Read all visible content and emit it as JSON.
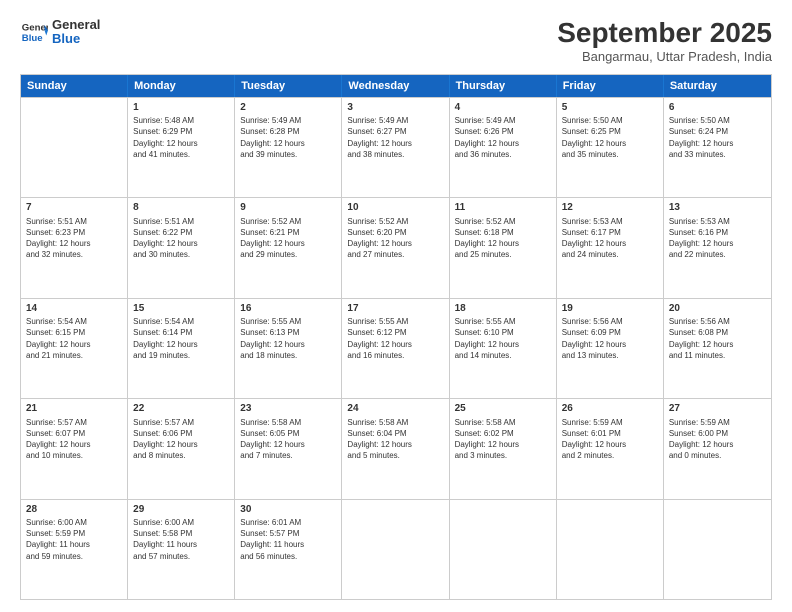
{
  "header": {
    "logo_line1": "General",
    "logo_line2": "Blue",
    "month_title": "September 2025",
    "subtitle": "Bangarmau, Uttar Pradesh, India"
  },
  "days_of_week": [
    "Sunday",
    "Monday",
    "Tuesday",
    "Wednesday",
    "Thursday",
    "Friday",
    "Saturday"
  ],
  "weeks": [
    [
      {
        "day": "",
        "info": ""
      },
      {
        "day": "1",
        "info": "Sunrise: 5:48 AM\nSunset: 6:29 PM\nDaylight: 12 hours\nand 41 minutes."
      },
      {
        "day": "2",
        "info": "Sunrise: 5:49 AM\nSunset: 6:28 PM\nDaylight: 12 hours\nand 39 minutes."
      },
      {
        "day": "3",
        "info": "Sunrise: 5:49 AM\nSunset: 6:27 PM\nDaylight: 12 hours\nand 38 minutes."
      },
      {
        "day": "4",
        "info": "Sunrise: 5:49 AM\nSunset: 6:26 PM\nDaylight: 12 hours\nand 36 minutes."
      },
      {
        "day": "5",
        "info": "Sunrise: 5:50 AM\nSunset: 6:25 PM\nDaylight: 12 hours\nand 35 minutes."
      },
      {
        "day": "6",
        "info": "Sunrise: 5:50 AM\nSunset: 6:24 PM\nDaylight: 12 hours\nand 33 minutes."
      }
    ],
    [
      {
        "day": "7",
        "info": "Sunrise: 5:51 AM\nSunset: 6:23 PM\nDaylight: 12 hours\nand 32 minutes."
      },
      {
        "day": "8",
        "info": "Sunrise: 5:51 AM\nSunset: 6:22 PM\nDaylight: 12 hours\nand 30 minutes."
      },
      {
        "day": "9",
        "info": "Sunrise: 5:52 AM\nSunset: 6:21 PM\nDaylight: 12 hours\nand 29 minutes."
      },
      {
        "day": "10",
        "info": "Sunrise: 5:52 AM\nSunset: 6:20 PM\nDaylight: 12 hours\nand 27 minutes."
      },
      {
        "day": "11",
        "info": "Sunrise: 5:52 AM\nSunset: 6:18 PM\nDaylight: 12 hours\nand 25 minutes."
      },
      {
        "day": "12",
        "info": "Sunrise: 5:53 AM\nSunset: 6:17 PM\nDaylight: 12 hours\nand 24 minutes."
      },
      {
        "day": "13",
        "info": "Sunrise: 5:53 AM\nSunset: 6:16 PM\nDaylight: 12 hours\nand 22 minutes."
      }
    ],
    [
      {
        "day": "14",
        "info": "Sunrise: 5:54 AM\nSunset: 6:15 PM\nDaylight: 12 hours\nand 21 minutes."
      },
      {
        "day": "15",
        "info": "Sunrise: 5:54 AM\nSunset: 6:14 PM\nDaylight: 12 hours\nand 19 minutes."
      },
      {
        "day": "16",
        "info": "Sunrise: 5:55 AM\nSunset: 6:13 PM\nDaylight: 12 hours\nand 18 minutes."
      },
      {
        "day": "17",
        "info": "Sunrise: 5:55 AM\nSunset: 6:12 PM\nDaylight: 12 hours\nand 16 minutes."
      },
      {
        "day": "18",
        "info": "Sunrise: 5:55 AM\nSunset: 6:10 PM\nDaylight: 12 hours\nand 14 minutes."
      },
      {
        "day": "19",
        "info": "Sunrise: 5:56 AM\nSunset: 6:09 PM\nDaylight: 12 hours\nand 13 minutes."
      },
      {
        "day": "20",
        "info": "Sunrise: 5:56 AM\nSunset: 6:08 PM\nDaylight: 12 hours\nand 11 minutes."
      }
    ],
    [
      {
        "day": "21",
        "info": "Sunrise: 5:57 AM\nSunset: 6:07 PM\nDaylight: 12 hours\nand 10 minutes."
      },
      {
        "day": "22",
        "info": "Sunrise: 5:57 AM\nSunset: 6:06 PM\nDaylight: 12 hours\nand 8 minutes."
      },
      {
        "day": "23",
        "info": "Sunrise: 5:58 AM\nSunset: 6:05 PM\nDaylight: 12 hours\nand 7 minutes."
      },
      {
        "day": "24",
        "info": "Sunrise: 5:58 AM\nSunset: 6:04 PM\nDaylight: 12 hours\nand 5 minutes."
      },
      {
        "day": "25",
        "info": "Sunrise: 5:58 AM\nSunset: 6:02 PM\nDaylight: 12 hours\nand 3 minutes."
      },
      {
        "day": "26",
        "info": "Sunrise: 5:59 AM\nSunset: 6:01 PM\nDaylight: 12 hours\nand 2 minutes."
      },
      {
        "day": "27",
        "info": "Sunrise: 5:59 AM\nSunset: 6:00 PM\nDaylight: 12 hours\nand 0 minutes."
      }
    ],
    [
      {
        "day": "28",
        "info": "Sunrise: 6:00 AM\nSunset: 5:59 PM\nDaylight: 11 hours\nand 59 minutes."
      },
      {
        "day": "29",
        "info": "Sunrise: 6:00 AM\nSunset: 5:58 PM\nDaylight: 11 hours\nand 57 minutes."
      },
      {
        "day": "30",
        "info": "Sunrise: 6:01 AM\nSunset: 5:57 PM\nDaylight: 11 hours\nand 56 minutes."
      },
      {
        "day": "",
        "info": ""
      },
      {
        "day": "",
        "info": ""
      },
      {
        "day": "",
        "info": ""
      },
      {
        "day": "",
        "info": ""
      }
    ]
  ]
}
